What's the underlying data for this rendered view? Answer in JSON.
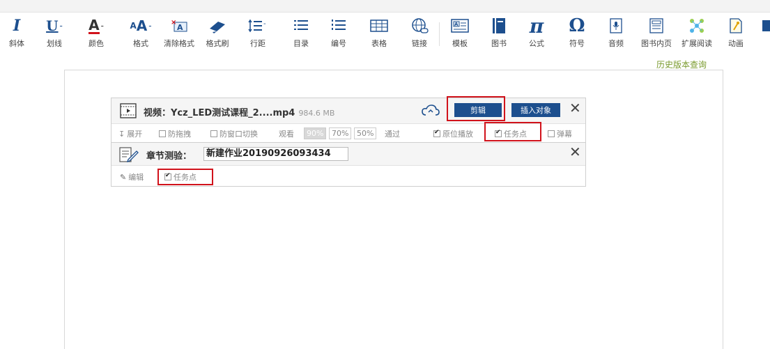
{
  "toolbar": {
    "items": [
      {
        "label": "斜体",
        "icon": "italic-icon"
      },
      {
        "label": "划线",
        "icon": "underline-icon"
      },
      {
        "label": "颜色",
        "icon": "font-color-icon"
      },
      {
        "label": "格式",
        "icon": "format-icon"
      },
      {
        "label": "清除格式",
        "icon": "clear-format-icon"
      },
      {
        "label": "格式刷",
        "icon": "format-painter-icon"
      },
      {
        "label": "行距",
        "icon": "line-spacing-icon"
      },
      {
        "label": "目录",
        "icon": "toc-icon"
      },
      {
        "label": "编号",
        "icon": "numbered-list-icon"
      },
      {
        "label": "表格",
        "icon": "table-icon"
      },
      {
        "label": "链接",
        "icon": "link-icon"
      },
      {
        "label": "模板",
        "icon": "template-icon"
      },
      {
        "label": "图书",
        "icon": "book-icon"
      },
      {
        "label": "公式",
        "icon": "formula-icon"
      },
      {
        "label": "符号",
        "icon": "symbol-icon"
      },
      {
        "label": "音频",
        "icon": "audio-icon"
      },
      {
        "label": "图书内页",
        "icon": "book-page-icon"
      },
      {
        "label": "扩展阅读",
        "icon": "extended-reading-icon"
      },
      {
        "label": "动画",
        "icon": "animation-icon"
      }
    ],
    "symbols": {
      "italic": "I",
      "underline": "U",
      "color": "A",
      "formula": "π",
      "symbol": "Ω",
      "dropdown": "-"
    }
  },
  "history_link": "历史版本查询",
  "video": {
    "title": "视频：Ycz_LED测试课程_2....mp4",
    "size": "984.6 MB",
    "edit_button": "剪辑",
    "insert_button": "插入对象",
    "close": "✕",
    "options": {
      "expand": "展开",
      "anti_drag": "防拖拽",
      "anti_window_switch": "防窗口切换",
      "watch_label": "观看",
      "percentages": [
        "90%",
        "70%",
        "50%"
      ],
      "active_percentage": "90%",
      "pass_label": "通过",
      "original_play": "原位播放",
      "task_point": "任务点",
      "barrage": "弹幕"
    },
    "checked": {
      "anti_drag": false,
      "anti_window_switch": false,
      "original_play": true,
      "task_point": true,
      "barrage": false
    }
  },
  "chapter_test": {
    "label": "章节测验：",
    "value": "新建作业20190926093434",
    "close": "✕",
    "edit": "编辑",
    "task_point": "任务点",
    "task_point_checked": true
  },
  "colors": {
    "accent_blue": "#1d4f8e",
    "highlight_red": "#d1121b",
    "history_green": "#7a9a2e",
    "icon_blue": "#1d4f8e"
  }
}
